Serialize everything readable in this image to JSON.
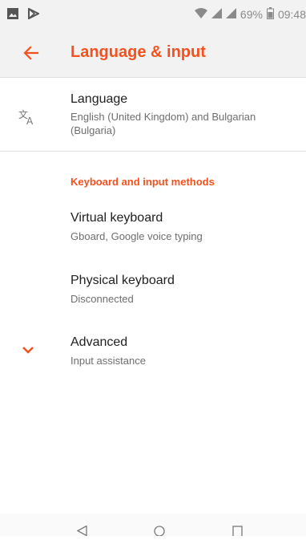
{
  "status_bar": {
    "battery_percent": "69%",
    "time": "09:48",
    "icons": [
      "image-notification-icon",
      "play-store-icon",
      "wifi-icon",
      "signal-icon",
      "signal-icon",
      "battery-icon"
    ]
  },
  "app_bar": {
    "title": "Language & input",
    "back_icon": "arrow-back-icon",
    "accent_color": "#f4511e"
  },
  "language": {
    "title": "Language",
    "summary": "English (United Kingdom) and Bulgarian (Bulgaria)",
    "icon": "translate-icon"
  },
  "section": {
    "header": "Keyboard and input methods"
  },
  "virtual_keyboard": {
    "title": "Virtual keyboard",
    "summary": "Gboard, Google voice typing"
  },
  "physical_keyboard": {
    "title": "Physical keyboard",
    "summary": "Disconnected"
  },
  "advanced": {
    "title": "Advanced",
    "summary": "Input assistance",
    "icon": "chevron-down-icon"
  },
  "nav_bar": {
    "buttons": [
      "back-nav-icon",
      "home-nav-icon",
      "recents-nav-icon"
    ]
  }
}
